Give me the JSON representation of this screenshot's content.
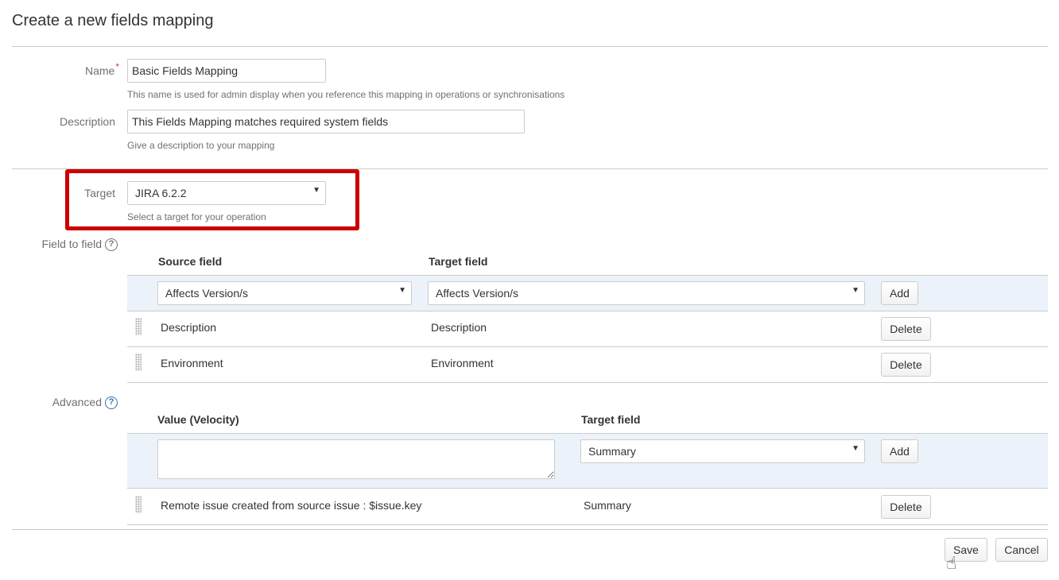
{
  "page": {
    "title": "Create a new fields mapping"
  },
  "name_field": {
    "label": "Name",
    "required_mark": "*",
    "value": "Basic Fields Mapping",
    "help": "This name is used for admin display when you reference this mapping in operations or synchronisations"
  },
  "description_field": {
    "label": "Description",
    "value": "This Fields Mapping matches required system fields",
    "help": "Give a description to your mapping"
  },
  "target_field": {
    "label": "Target",
    "selected": "JIRA 6.2.2",
    "help": "Select a target for your operation"
  },
  "field_to_field": {
    "label": "Field to field",
    "columns": {
      "source": "Source field",
      "target": "Target field"
    },
    "new_row": {
      "source_selected": "Affects Version/s",
      "target_selected": "Affects Version/s",
      "add_label": "Add"
    },
    "rows": [
      {
        "source": "Description",
        "target": "Description",
        "delete_label": "Delete"
      },
      {
        "source": "Environment",
        "target": "Environment",
        "delete_label": "Delete"
      }
    ]
  },
  "advanced": {
    "label": "Advanced",
    "columns": {
      "value": "Value (Velocity)",
      "target": "Target field"
    },
    "new_row": {
      "value": "",
      "target_selected": "Summary",
      "add_label": "Add"
    },
    "rows": [
      {
        "value": "Remote issue created from source issue : $issue.key",
        "target": "Summary",
        "delete_label": "Delete"
      }
    ]
  },
  "footer": {
    "save_label": "Save",
    "cancel_label": "Cancel"
  },
  "icons": {
    "help": "question-circle-icon",
    "dropdown": "caret-down-icon",
    "drag": "drag-handle-icon",
    "cursor": "hand-pointer-icon"
  },
  "colors": {
    "highlight": "#cc0000",
    "row_band": "#ebf2f9",
    "required": "#d04437",
    "help_blue": "#3572b0"
  }
}
